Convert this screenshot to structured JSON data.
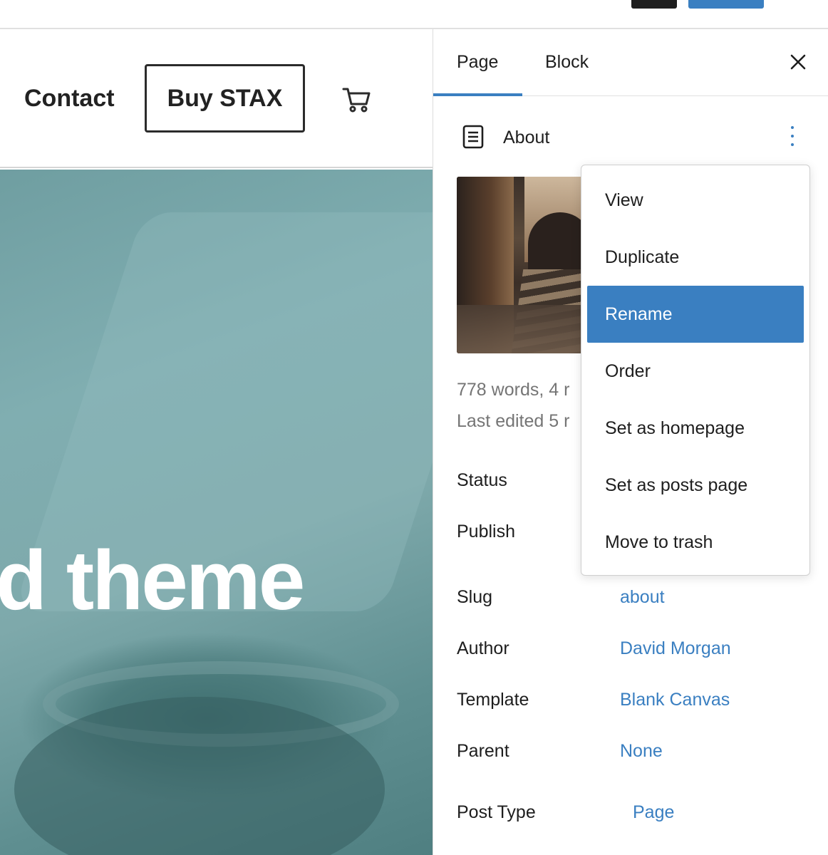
{
  "canvas": {
    "nav_contact": "Contact",
    "buy_button": "Buy STAX",
    "hero_title": "d theme"
  },
  "sidebar": {
    "tabs": [
      {
        "label": "Page",
        "active": true
      },
      {
        "label": "Block",
        "active": false
      }
    ],
    "document": {
      "title": "About",
      "meta_words": "778 words, 4 r",
      "meta_edited": "Last edited 5 r"
    },
    "properties": [
      {
        "label": "Status",
        "value": ""
      },
      {
        "label": "Publish",
        "value": ""
      },
      {
        "label": "Slug",
        "value": "about"
      },
      {
        "label": "Author",
        "value": "David Morgan"
      },
      {
        "label": "Template",
        "value": "Blank Canvas"
      },
      {
        "label": "Parent",
        "value": "None"
      },
      {
        "label": "Post Type",
        "value": "Page"
      }
    ]
  },
  "menu": {
    "items": [
      {
        "label": "View",
        "active": false
      },
      {
        "label": "Duplicate",
        "active": false
      },
      {
        "label": "Rename",
        "active": true
      },
      {
        "label": "Order",
        "active": false
      },
      {
        "label": "Set as homepage",
        "active": false
      },
      {
        "label": "Set as posts page",
        "active": false
      },
      {
        "label": "Move to trash",
        "active": false
      }
    ]
  },
  "colors": {
    "accent": "#3a7fc1",
    "text": "#1e1e1e",
    "muted": "#757575"
  }
}
